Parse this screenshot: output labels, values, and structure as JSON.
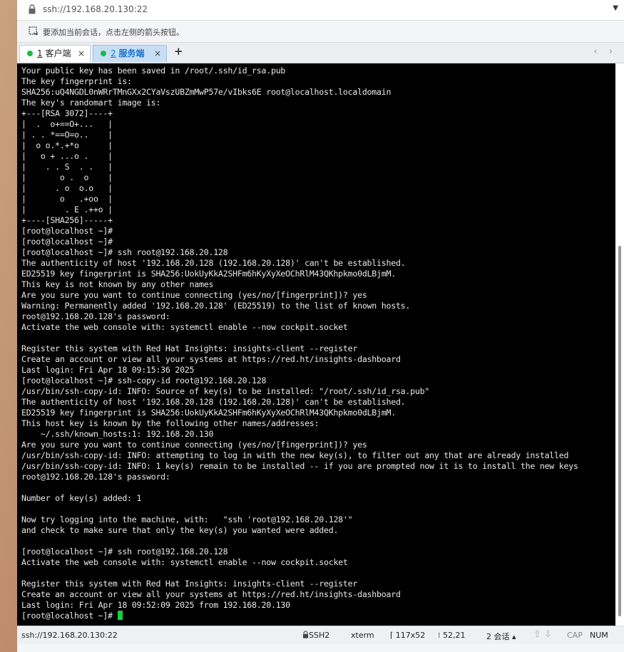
{
  "address_bar": {
    "value": "ssh://192.168.20.130:22"
  },
  "hint": {
    "text": "要添加当前会话，点击左侧的箭头按钮。"
  },
  "tabs": [
    {
      "num": "1",
      "label": "客户端",
      "close": "×"
    },
    {
      "num": "2",
      "label": "服务端",
      "close": "×"
    }
  ],
  "tab_add": "+",
  "tab_nav": "‹ ›",
  "terminal": {
    "lines": [
      "Your public key has been saved in /root/.ssh/id_rsa.pub",
      "The key fingerprint is:",
      "SHA256:uQ4NGDL0nWRrTMnGXx2CYaVszUBZmMwP57e/vIbks6E root@localhost.localdomain",
      "The key's randomart image is:",
      "+---[RSA 3072]----+",
      "|  .  o+==O+...   |",
      "| . . *==O=o..    |",
      "|  o o.*.+*o      |",
      "|   o + ...o .    |",
      "|    . . S  . .   |",
      "|       o .  o    |",
      "|      . o  o.o   |",
      "|       o   .+oo  |",
      "|        . E .++o |",
      "+----[SHA256]-----+",
      "[root@localhost ~]#",
      "[root@localhost ~]#",
      "[root@localhost ~]# ssh root@192.168.20.128",
      "The authenticity of host '192.168.20.128 (192.168.20.128)' can't be established.",
      "ED25519 key fingerprint is SHA256:UokUyKkA2SHFm6hKyXyXeOChRlM43QKhpkmo0dLBjmM.",
      "This key is not known by any other names",
      "Are you sure you want to continue connecting (yes/no/[fingerprint])? yes",
      "Warning: Permanently added '192.168.20.128' (ED25519) to the list of known hosts.",
      "root@192.168.20.128's password:",
      "Activate the web console with: systemctl enable --now cockpit.socket",
      "",
      "Register this system with Red Hat Insights: insights-client --register",
      "Create an account or view all your systems at https://red.ht/insights-dashboard",
      "Last login: Fri Apr 18 09:15:36 2025",
      "[root@localhost ~]# ssh-copy-id root@192.168.20.128",
      "/usr/bin/ssh-copy-id: INFO: Source of key(s) to be installed: \"/root/.ssh/id_rsa.pub\"",
      "The authenticity of host '192.168.20.128 (192.168.20.128)' can't be established.",
      "ED25519 key fingerprint is SHA256:UokUyKkA2SHFm6hKyXyXeOChRlM43QKhpkmo0dLBjmM.",
      "This host key is known by the following other names/addresses:",
      "    ~/.ssh/known_hosts:1: 192.168.20.130",
      "Are you sure you want to continue connecting (yes/no/[fingerprint])? yes",
      "/usr/bin/ssh-copy-id: INFO: attempting to log in with the new key(s), to filter out any that are already installed",
      "/usr/bin/ssh-copy-id: INFO: 1 key(s) remain to be installed -- if you are prompted now it is to install the new keys",
      "root@192.168.20.128's password:",
      "",
      "Number of key(s) added: 1",
      "",
      "Now try logging into the machine, with:   \"ssh 'root@192.168.20.128'\"",
      "and check to make sure that only the key(s) you wanted were added.",
      "",
      "[root@localhost ~]# ssh root@192.168.20.128",
      "Activate the web console with: systemctl enable --now cockpit.socket",
      "",
      "Register this system with Red Hat Insights: insights-client --register",
      "Create an account or view all your systems at https://red.ht/insights-dashboard",
      "Last login: Fri Apr 18 09:52:09 2025 from 192.168.20.130"
    ],
    "prompt": "[root@localhost ~]# "
  },
  "status_bar": {
    "host": "ssh://192.168.20.130:22",
    "protocol": "SSH2",
    "term_type": "xterm",
    "size": "117x52",
    "cursor_pos": "52,21",
    "sessions": "2 会话",
    "caps": "CAP",
    "num": "NUM"
  },
  "colors": {
    "cursor": "#19d236",
    "active_tab": "#c7dff5",
    "tab_dot": "#1db84a"
  },
  "icons": [
    "lock-icon",
    "dropdown-arrow-icon",
    "add-session-icon",
    "status-dot-icon",
    "close-icon",
    "scroll-left-icon",
    "scroll-right-icon"
  ]
}
